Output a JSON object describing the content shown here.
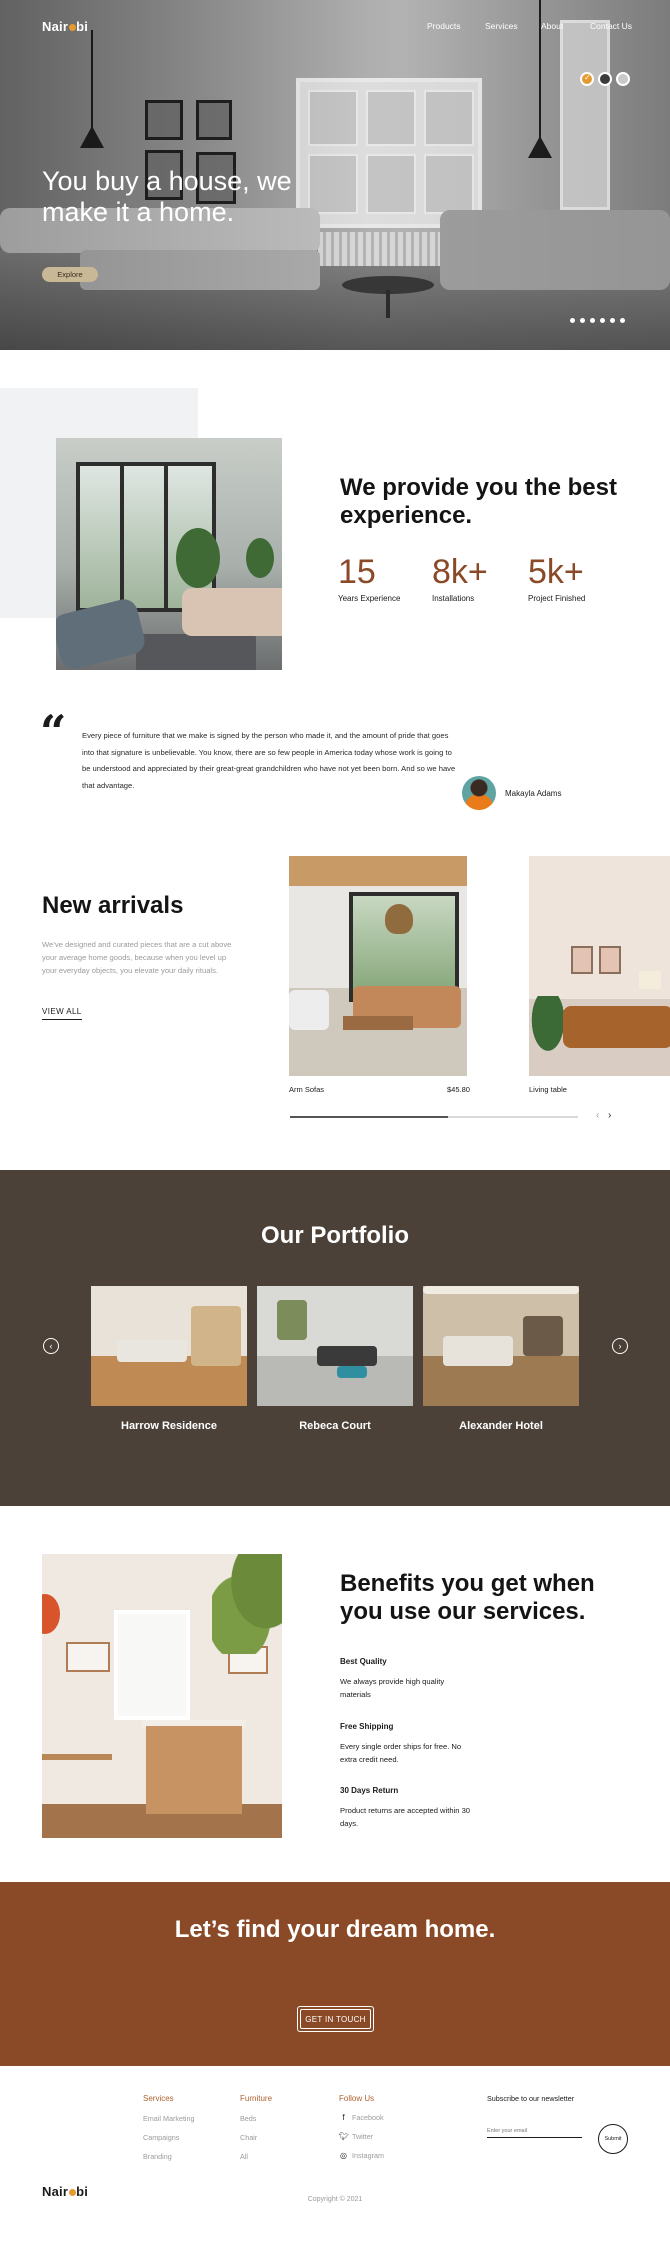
{
  "brand": {
    "name_before": "Nair",
    "name_after": "bi",
    "accent": "#e59a2f"
  },
  "nav": {
    "items": [
      "Products",
      "Services",
      "About",
      "Contact Us"
    ]
  },
  "hero": {
    "title": "You buy a house, we make it a home.",
    "cta_label": "Explore",
    "swatch_colors": [
      "#e59a2f",
      "#3b3b3b",
      "#c9c9c9"
    ],
    "active_swatch": 0,
    "slides_total": 6,
    "active_slide": 0
  },
  "experience": {
    "title": "We provide you the best experience.",
    "stats": [
      {
        "value": "15",
        "label": "Years Experience"
      },
      {
        "value": "8k+",
        "label": "Installations"
      },
      {
        "value": "5k+",
        "label": "Project Finished"
      }
    ]
  },
  "testimonial": {
    "quote_mark": "“",
    "text": "Every piece of furniture that we make is signed by the person who made it, and the amount of pride that goes into that signature is unbelievable. You know, there are so few people in America today whose work is going to be understood and appreciated by their great-great grandchildren who have not yet been born. And so we have that advantage.",
    "author": "Makayla Adams"
  },
  "arrivals": {
    "title": "New arrivals",
    "description": "We’ve designed and curated pieces that are a cut above your average home goods, because when you level up your everyday objects, you elevate your daily rituals.",
    "view_all": "VIEW ALL",
    "products": [
      {
        "name": "Arm Sofas",
        "price": "$45.80"
      },
      {
        "name": "Living table",
        "price": ""
      }
    ],
    "scroll_progress": 0.55,
    "prev_icon": "chevron-left-icon",
    "next_icon": "chevron-right-icon"
  },
  "portfolio": {
    "title": "Our Portfolio",
    "background": "#4c4138",
    "projects": [
      "Harrow Residence",
      "Rebeca Court",
      "Alexander Hotel"
    ]
  },
  "benefits": {
    "title": "Benefits you get when you use our services.",
    "items": [
      {
        "title": "Best Quality",
        "text": "We always provide high quality materials"
      },
      {
        "title": "Free Shipping",
        "text": "Every single order ships for free. No extra credit need."
      },
      {
        "title": "30 Days Return",
        "text": "Product returns are accepted within 30 days."
      }
    ]
  },
  "cta": {
    "title": "Let’s find your dream home.",
    "button": "GET IN TOUCH",
    "background": "#8a4a27"
  },
  "footer": {
    "services": {
      "heading": "Services",
      "links": [
        "Email Marketing",
        "Campaigns",
        "Branding"
      ]
    },
    "furniture": {
      "heading": "Furniture",
      "links": [
        "Beds",
        "Chair",
        "All"
      ]
    },
    "follow": {
      "heading": "Follow Us",
      "links": [
        "Facebook",
        "Twitter",
        "Instagram"
      ]
    },
    "newsletter": {
      "label": "Subscribe to our newsletter",
      "placeholder": "Enter your email",
      "submit": "Submit"
    },
    "copyright": "Copyright © 2021",
    "heading_color": "#b0632f"
  }
}
